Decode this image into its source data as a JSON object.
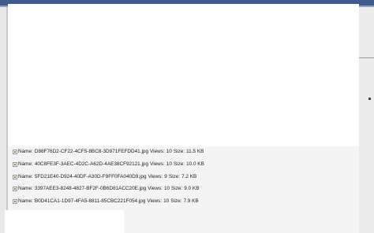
{
  "file_list": {
    "items": [
      {
        "name_label": "Name:",
        "filename": "D88F76D2-CF22-4CF5-8BC8-3D971FEFDD41.jpg",
        "views_label": "Views:",
        "views": "10",
        "size_label": "Size:",
        "size": "11.5 KB",
        "icon": "broken-image-icon"
      },
      {
        "name_label": "Name:",
        "filename": "40C8FE3F-3AEC-4D2C-A62D-4AE38CF92121.jpg",
        "views_label": "Views:",
        "views": "10",
        "size_label": "Size:",
        "size": "10.0 KB",
        "icon": "broken-image-icon"
      },
      {
        "name_label": "Name:",
        "filename": "5FD21E40-D924-40DF-A30D-F9FF0FA040D9.jpg",
        "views_label": "Views:",
        "views": "9",
        "size_label": "Size:",
        "size": "7.2 KB",
        "icon": "broken-image-icon"
      },
      {
        "name_label": "Name:",
        "filename": "3397AEE3-8248-4827-BF2F-0B6D81ACC20E.jpg",
        "views_label": "Views:",
        "views": "10",
        "size_label": "Size:",
        "size": "9.0 KB",
        "icon": "broken-image-icon"
      },
      {
        "name_label": "Name:",
        "filename": "B0D41CA1-1D97-4FA5-8811-85CBC221F054.jpg",
        "views_label": "Views:",
        "views": "10",
        "size_label": "Size:",
        "size": "7.9 KB",
        "icon": "broken-image-icon"
      }
    ]
  },
  "colors": {
    "header_bar": "#3f5a8c",
    "background": "#f2f2f2",
    "text": "#222222"
  }
}
